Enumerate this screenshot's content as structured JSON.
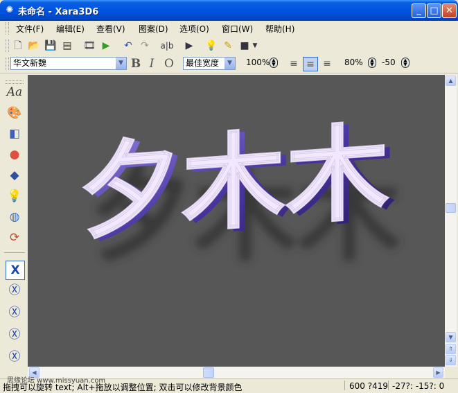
{
  "window": {
    "title": "未命名 - Xara3D6",
    "icon": "xara-swirl-icon",
    "controls": [
      "minimize-icon",
      "maximize-icon",
      "close-icon"
    ]
  },
  "menu": [
    "文件(F)",
    "编辑(E)",
    "查看(V)",
    "图案(D)",
    "选项(O)",
    "窗口(W)",
    "帮助(H)"
  ],
  "toolbar": {
    "icons": [
      "new-icon",
      "open-icon",
      "save-icon",
      "export-icon",
      "film-icon",
      "play-icon",
      "undo-icon",
      "redo-icon",
      "text-edit-icon",
      "animation-icon",
      "bulb-icon",
      "magic-icon",
      "window-icon"
    ]
  },
  "format_bar": {
    "font": "华文新魏",
    "bold": "B",
    "italic": "I",
    "outline": "O",
    "spacing": "最佳宽度",
    "zoom": "100%",
    "line_spacing": "80%",
    "kerning": "-50"
  },
  "left_tools": [
    "text-style-icon",
    "color-palette-icon",
    "extrude-icon",
    "shadow-icon",
    "bevel-icon",
    "lighting-icon",
    "texture-icon",
    "view-rotate-icon",
    "x-template-icon-1",
    "x-template-icon-2",
    "x-template-icon-3",
    "x-template-icon-4",
    "x-template-icon-5"
  ],
  "left_tools_text": {
    "text_style": "Aa"
  },
  "canvas": {
    "text": "夕木木",
    "background": "#575757",
    "face_color": "#f2e8ff",
    "side_color": "#6a54b8"
  },
  "statusbar": {
    "hint": "拖拽可以旋转 text; Alt+拖放以调整位置; 双击可以修改背景颜色",
    "size": "600 ?419",
    "angles": "-27?: -15?: 0",
    "watermark": "思缘论坛 www.missyuan.com"
  }
}
